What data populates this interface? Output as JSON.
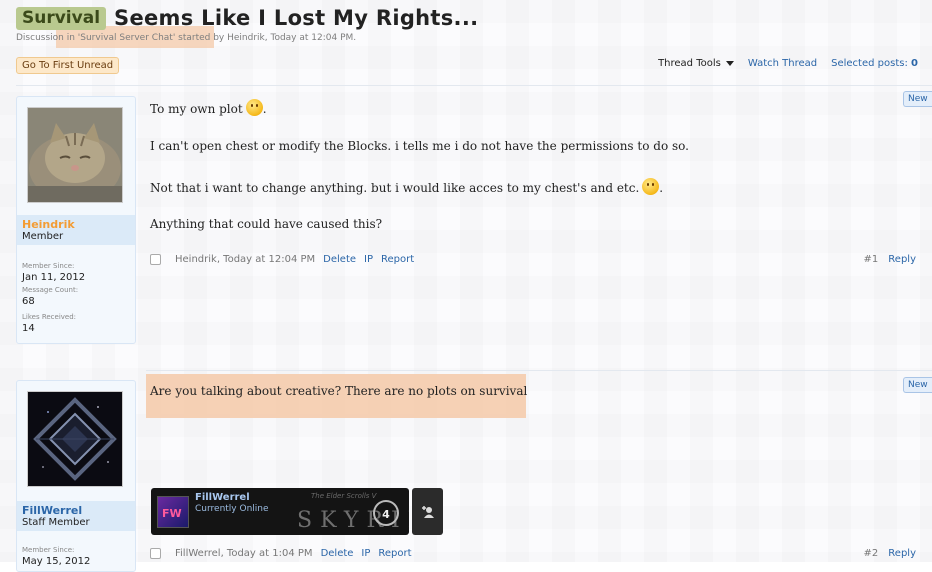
{
  "thread": {
    "prefix": "Survival",
    "title": "Seems Like I Lost My Rights...",
    "description": "Discussion in 'Survival Server Chat' started by Heindrik, Today at 12:04 PM."
  },
  "toolbar": {
    "first_unread": "Go To First Unread",
    "thread_tools": "Thread Tools",
    "watch_thread": "Watch Thread",
    "selected_posts_label": "Selected posts:",
    "selected_posts_count": "0"
  },
  "posts": [
    {
      "user": {
        "name": "Heindrik",
        "role": "Member",
        "member_since_label": "Member Since:",
        "member_since": "Jan 11, 2012",
        "message_count_label": "Message Count:",
        "message_count": "68",
        "likes_label": "Likes Received:",
        "likes": "14",
        "name_color": "#f39c34"
      },
      "new_tag": "New",
      "paragraphs": [
        "To my own plot",
        "I can't open chest or modify the Blocks. i tells me i do not have the permissions to do so.",
        "Not that i want to change anything. but i would like acces to my chest's and etc.",
        "Anything that could have caused this?"
      ],
      "footer": {
        "author_time": "Heindrik, Today at 12:04 PM",
        "delete": "Delete",
        "ip": "IP",
        "report": "Report",
        "number": "#1",
        "reply": "Reply"
      }
    },
    {
      "user": {
        "name": "FillWerrel",
        "role": "Staff Member",
        "member_since_label": "Member Since:",
        "member_since": "May 15, 2012",
        "name_color": "#2b66a8"
      },
      "new_tag": "New",
      "paragraphs": [
        "Are you talking about creative? There are no plots on survival"
      ],
      "signature": {
        "name": "FillWerrel",
        "status": "Currently Online",
        "game_small": "The Elder Scrolls V",
        "game_logo": "SKYRIM",
        "badge": "4",
        "add_icon": "add-friend-icon"
      },
      "footer": {
        "author_time": "FillWerrel, Today at 1:04 PM",
        "delete": "Delete",
        "ip": "IP",
        "report": "Report",
        "number": "#2",
        "reply": "Reply"
      }
    }
  ],
  "colors": {
    "link": "#2b66a8",
    "prefix_bg": "#b9c98f",
    "highlight": "#f4c9a8"
  }
}
